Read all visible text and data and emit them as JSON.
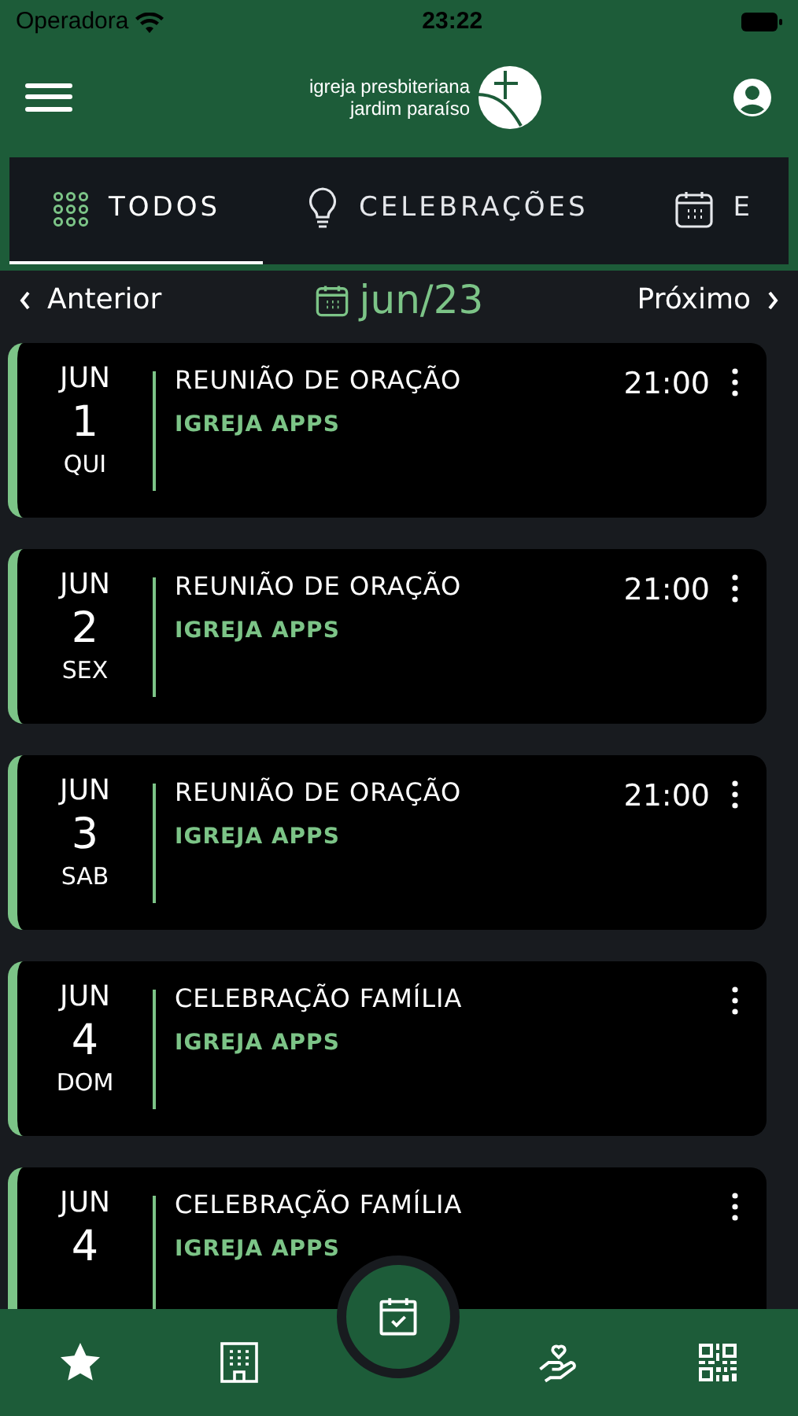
{
  "status_bar": {
    "carrier": "Operadora",
    "time": "23:22"
  },
  "header": {
    "logo_line_1": "igreja presbiteriana",
    "logo_line_2": "jardim paraíso"
  },
  "tabs": [
    {
      "label": "TODOS",
      "kind": "grid",
      "selected": true
    },
    {
      "label": "CELEBRAÇÕES",
      "kind": "bulb",
      "selected": false
    },
    {
      "label": "E",
      "kind": "calendar",
      "selected": false
    }
  ],
  "month_nav": {
    "previous": "Anterior",
    "current": "jun/23",
    "next": "Próximo"
  },
  "events": [
    {
      "month": "JUN",
      "day": "1",
      "weekday": "QUI",
      "title": "REUNIÃO DE ORAÇÃO",
      "organizer": "IGREJA APPS",
      "time": "21:00"
    },
    {
      "month": "JUN",
      "day": "2",
      "weekday": "SEX",
      "title": "REUNIÃO DE ORAÇÃO",
      "organizer": "IGREJA APPS",
      "time": "21:00"
    },
    {
      "month": "JUN",
      "day": "3",
      "weekday": "SAB",
      "title": "REUNIÃO DE ORAÇÃO",
      "organizer": "IGREJA APPS",
      "time": "21:00"
    },
    {
      "month": "JUN",
      "day": "4",
      "weekday": "DOM",
      "title": "CELEBRAÇÃO FAMÍLIA",
      "organizer": "IGREJA APPS"
    },
    {
      "month": "JUN",
      "day": "4",
      "title": "CELEBRAÇÃO FAMÍLIA",
      "organizer": "IGREJA APPS"
    }
  ],
  "bottom_nav": [
    {
      "kind": "star",
      "selected": false
    },
    {
      "kind": "building",
      "selected": false
    },
    {
      "kind": "calendar",
      "selected": true
    },
    {
      "kind": "charity",
      "selected": false
    },
    {
      "kind": "qr",
      "selected": false
    }
  ]
}
